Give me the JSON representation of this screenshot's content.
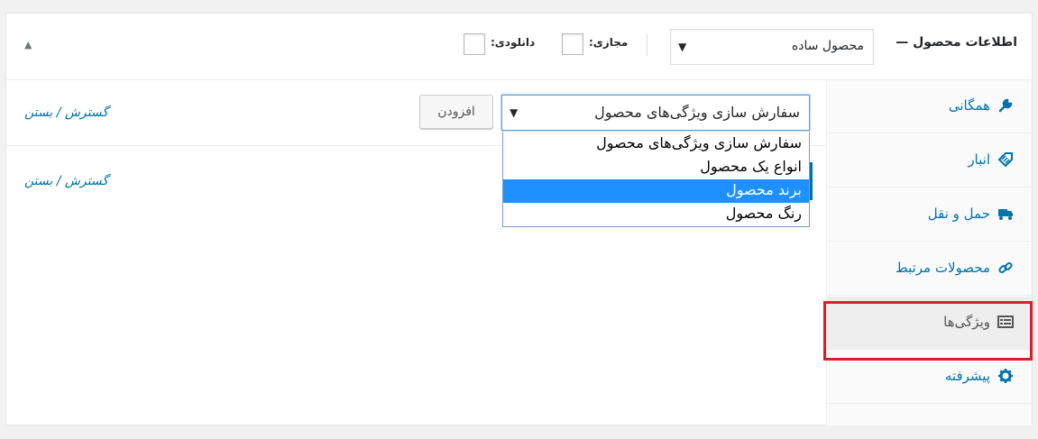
{
  "header": {
    "title": "اطلاعات محصول —",
    "product_type": "محصول ساده",
    "virtual_label": "مجازی:",
    "downloadable_label": "دانلودی:"
  },
  "tabs": [
    {
      "label": "همگانی",
      "icon": "wrench-icon"
    },
    {
      "label": "انبار",
      "icon": "tag-icon"
    },
    {
      "label": "حمل و نقل",
      "icon": "truck-icon"
    },
    {
      "label": "محصولات مرتبط",
      "icon": "link-icon"
    },
    {
      "label": "ویژگی‌ها",
      "icon": "table-icon",
      "active": true
    },
    {
      "label": "پیشرفته",
      "icon": "gear-icon"
    }
  ],
  "toolbar": {
    "expand_collapse": "گسترش / بستن",
    "add_button": "افزودن",
    "attribute_select": "سفارش سازی ویژگی‌های محصول"
  },
  "dropdown": {
    "options": [
      "سفارش سازی ویژگی‌های محصول",
      "انواع یک محصول",
      "برند محصول",
      "رنگ محصول"
    ],
    "selected_index": 2
  },
  "body": {
    "expand_collapse": "گسترش / بستن"
  },
  "colors": {
    "link": "#0073aa",
    "highlight": "#dc1e2a",
    "selected_option": "#1e90ff"
  }
}
